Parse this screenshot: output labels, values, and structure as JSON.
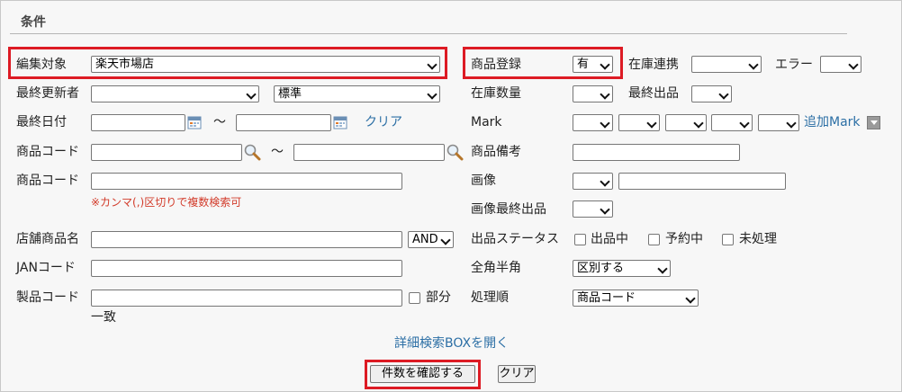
{
  "section": {
    "title": "条件"
  },
  "row1": {
    "edit_target_label": "編集対象",
    "edit_target_value": "楽天市場店",
    "product_reg_label": "商品登録",
    "product_reg_value": "有",
    "stock_link_label": "在庫連携",
    "stock_link_value": "",
    "error_label": "エラー",
    "error_value": ""
  },
  "row2": {
    "last_updater_label": "最終更新者",
    "last_updater_value": "",
    "standard_value": "標準",
    "stock_qty_label": "在庫数量",
    "stock_qty_value": "",
    "last_listing_label": "最終出品",
    "last_listing_value": ""
  },
  "row3": {
    "last_date_label": "最終日付",
    "tilde": "～",
    "clear_link": "クリア",
    "mark_label": "Mark",
    "add_mark_link": "追加Mark"
  },
  "row4": {
    "product_code_label": "商品コード",
    "tilde": "～",
    "product_note_label": "商品備考"
  },
  "row5": {
    "product_code_label": "商品コード",
    "comma_note": "※カンマ(,)区切りで複数検索可",
    "image_label": "画像",
    "image_value": ""
  },
  "row6": {
    "image_last_listing_label": "画像最終出品",
    "image_last_listing_value": ""
  },
  "row7": {
    "store_product_name_label": "店舗商品名",
    "and_value": "AND",
    "listing_status_label": "出品ステータス",
    "status_listing": "出品中",
    "status_reserved": "予約中",
    "status_unprocessed": "未処理"
  },
  "row8": {
    "jan_label": "JANコード",
    "width_label": "全角半角",
    "width_value": "区別する"
  },
  "row9": {
    "mfg_code_label": "製品コード",
    "partial_label": "部分",
    "partial_label2": "一致",
    "order_label": "処理順",
    "order_value": "商品コード"
  },
  "footer": {
    "detail_link": "詳細検索BOXを開く",
    "confirm_button": "件数を確認する",
    "clear_button": "クリア"
  },
  "colors": {
    "highlight": "#dd1b24",
    "link": "#2c6fa5",
    "note": "#d23b2a"
  }
}
